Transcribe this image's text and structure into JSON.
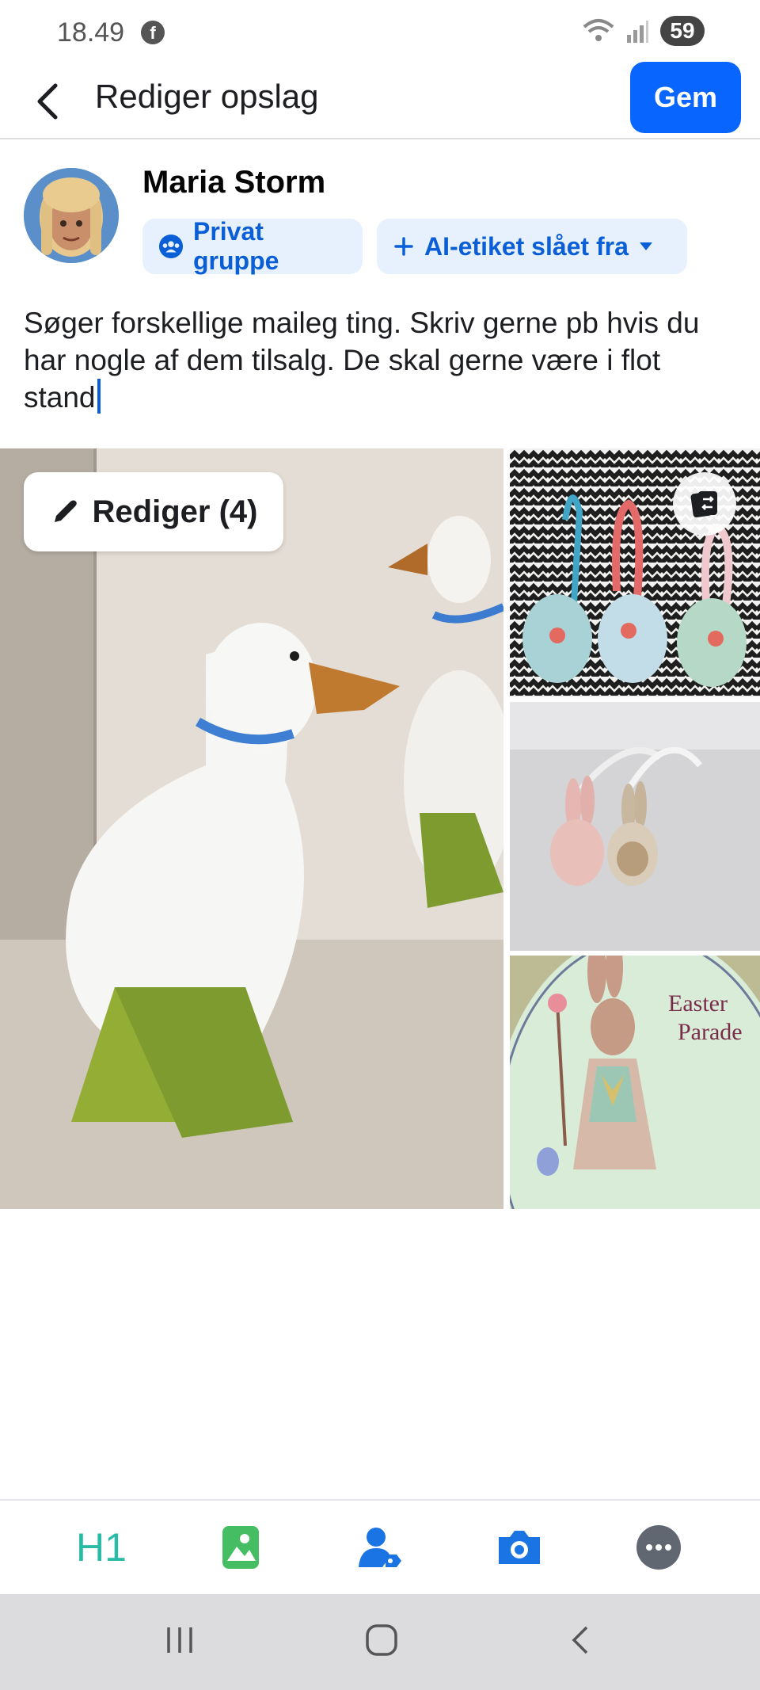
{
  "status_bar": {
    "time": "18.49",
    "battery": "59",
    "fb_glyph": "f"
  },
  "header": {
    "title": "Rediger opslag",
    "save_label": "Gem"
  },
  "author": {
    "name": "Maria Storm"
  },
  "chips": {
    "privacy_label": "Privat gruppe",
    "ai_label": "AI-etiket slået fra"
  },
  "post": {
    "text": "Søger forskellige maileg ting. Skriv gerne pb hvis du har nogle af dem tilsalg. De skal gerne være i flot stand"
  },
  "photos": {
    "edit_label": "Rediger (4)",
    "easter_text_line1": "Easter",
    "easter_text_line2": "Parade"
  },
  "toolbar": {
    "heading_label": "H1"
  },
  "colors": {
    "accent": "#0866ff",
    "chip_bg": "#e7f0fd",
    "chip_text": "#0a5fd6",
    "h1": "#2abba7",
    "photo_green": "#45bd62",
    "tag_blue": "#1b74e4"
  }
}
